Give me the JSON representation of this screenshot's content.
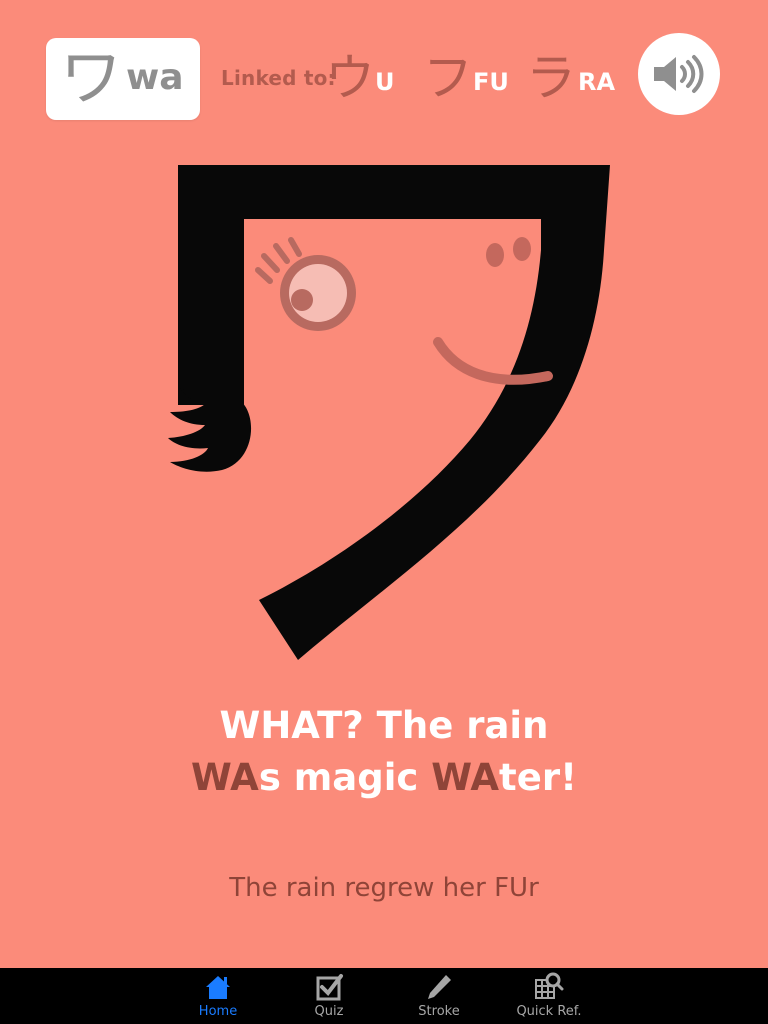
{
  "card": {
    "kana": "ワ",
    "romaji": "wa"
  },
  "linked": {
    "label": "Linked to:",
    "items": [
      {
        "kana": "ウ",
        "romaji": "U"
      },
      {
        "kana": "フ",
        "romaji": "FU"
      },
      {
        "kana": "ラ",
        "romaji": "RA"
      }
    ]
  },
  "sound_icon": "speaker-icon",
  "mnemonic": {
    "line1": "WHAT? The rain",
    "line2_parts": [
      {
        "text": "WA",
        "accent": true
      },
      {
        "text": "s magic ",
        "accent": false
      },
      {
        "text": "WA",
        "accent": true
      },
      {
        "text": "ter!",
        "accent": false
      }
    ]
  },
  "subtext": "The rain regrew her FUr",
  "tabs": [
    {
      "label": "Home",
      "icon": "home-icon",
      "active": true
    },
    {
      "label": "Quiz",
      "icon": "checkbox-icon",
      "active": false
    },
    {
      "label": "Stroke",
      "icon": "pencil-icon",
      "active": false
    },
    {
      "label": "Quick Ref.",
      "icon": "grid-search-icon",
      "active": false
    }
  ],
  "colors": {
    "background": "#fb8b7a",
    "accent_text": "#8f4438",
    "linked_kana": "#b35b4e",
    "tab_active": "#1a7cff",
    "tab_inactive": "#a6a6a6"
  }
}
